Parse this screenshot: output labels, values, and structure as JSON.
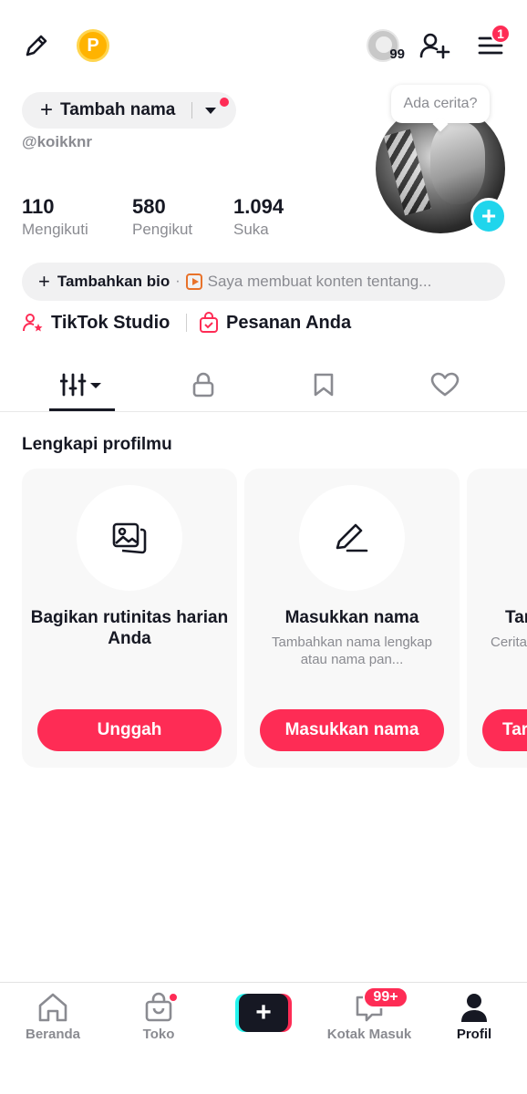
{
  "colors": {
    "accent": "#FE2C55",
    "cyan": "#20D5EC",
    "text": "#161823",
    "muted": "#8a8b91"
  },
  "topbar": {
    "edit_icon": "pencil-icon",
    "coin_label": "P",
    "avatar_count": "99",
    "add_friend_icon": "add-user-icon",
    "menu_icon": "hamburger-icon",
    "menu_badge": "1"
  },
  "profile": {
    "add_name_label": "Tambah nama",
    "username": "@koikknr",
    "story_prompt": "Ada cerita?",
    "stats": [
      {
        "value": "110",
        "label": "Mengikuti"
      },
      {
        "value": "580",
        "label": "Pengikut"
      },
      {
        "value": "1.094",
        "label": "Suka"
      }
    ],
    "bio_label": "Tambahkan bio",
    "bio_hint": "Saya membuat konten tentang...",
    "links": [
      {
        "label": "TikTok Studio",
        "icon": "studio-icon"
      },
      {
        "label": "Pesanan Anda",
        "icon": "shopping-bag-icon"
      }
    ]
  },
  "tabs": [
    {
      "icon": "grid-icon",
      "active": true
    },
    {
      "icon": "lock-icon"
    },
    {
      "icon": "bookmark-icon"
    },
    {
      "icon": "heart-icon"
    }
  ],
  "complete_profile": {
    "title": "Lengkapi profilmu",
    "cards": [
      {
        "icon": "photos-icon",
        "title": "Bagikan rutinitas harian Anda",
        "description": "",
        "cta": "Unggah"
      },
      {
        "icon": "pen-icon",
        "title": "Masukkan nama",
        "description": "Tambahkan nama lengkap atau nama pan...",
        "cta": "Masukkan nama"
      },
      {
        "icon": "",
        "title": "Tar",
        "description": "Cerita ter",
        "cta": "Tar"
      }
    ]
  },
  "bottom_nav": {
    "items": [
      {
        "label": "Beranda",
        "icon": "home-icon"
      },
      {
        "label": "Toko",
        "icon": "shop-icon"
      },
      {
        "label": "",
        "icon": "create-icon"
      },
      {
        "label": "Kotak Masuk",
        "icon": "inbox-icon",
        "badge": "99+"
      },
      {
        "label": "Profil",
        "icon": "profile-icon",
        "active": true
      }
    ]
  }
}
